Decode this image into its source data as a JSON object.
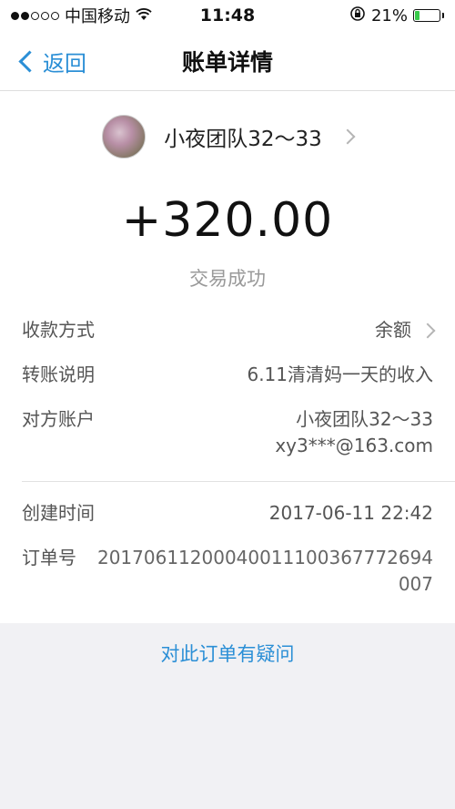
{
  "status_bar": {
    "carrier": "中国移动",
    "time": "11:48",
    "battery_percent": "21%",
    "battery_level": 0.21,
    "battery_color": "#38c94a",
    "signal_dots_filled": 2,
    "signal_dots_total": 5
  },
  "nav": {
    "back_label": "返回",
    "title": "账单详情"
  },
  "payee": {
    "name": "小夜团队32～33"
  },
  "transaction": {
    "amount": "+320.00",
    "status": "交易成功"
  },
  "details": {
    "payment_method_label": "收款方式",
    "payment_method_value": "余额",
    "note_label": "转账说明",
    "note_value": "6.11清清妈一天的收入",
    "account_label": "对方账户",
    "account_name": "小夜团队32～33",
    "account_email": "xy3***@163.com",
    "created_label": "创建时间",
    "created_value": "2017-06-11 22:42",
    "order_label": "订单号",
    "order_value": "20170611200040011100367772694007"
  },
  "question_link": "对此订单有疑问",
  "colors": {
    "accent": "#2b8fd6"
  }
}
